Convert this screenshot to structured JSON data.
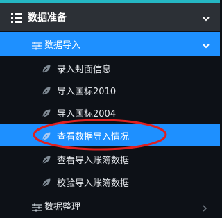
{
  "menu": {
    "title": "数据准备",
    "icon": "list-icon",
    "expanded": true
  },
  "submenu": {
    "title": "数据导入",
    "icon": "sliders-icon",
    "expanded": true,
    "items": [
      {
        "label": "录入封面信息",
        "icon": "leaf-icon",
        "active": false
      },
      {
        "label": "导入国标2010",
        "icon": "leaf-icon",
        "active": false
      },
      {
        "label": "导入国标2004",
        "icon": "leaf-icon",
        "active": false
      },
      {
        "label": "查看数据导入情况",
        "icon": "leaf-icon",
        "active": true
      },
      {
        "label": "查看导入账簿数据",
        "icon": "leaf-icon",
        "active": false
      },
      {
        "label": "校验导入账簿数据",
        "icon": "leaf-icon",
        "active": false
      }
    ]
  },
  "bottom_menu": {
    "title": "数据整理",
    "icon": "sliders-icon",
    "expanded": false
  },
  "colors": {
    "accent": "#1e90ff",
    "top_strip": "#25b7c4",
    "background": "#0d1117",
    "header_bg": "#2c3036",
    "annotation": "#e02020"
  }
}
